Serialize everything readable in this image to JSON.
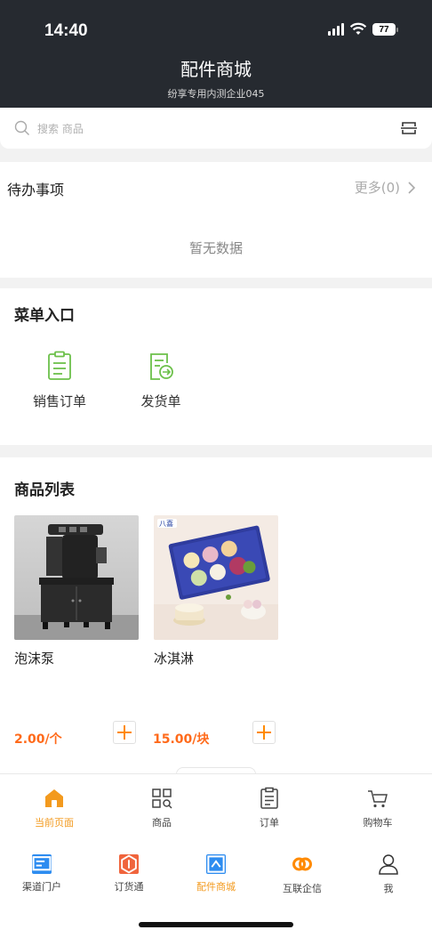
{
  "status": {
    "time": "14:40",
    "battery": "77"
  },
  "header": {
    "title": "配件商城",
    "subtitle": "纷享专用内测企业045"
  },
  "search": {
    "placeholder": "搜索 商品"
  },
  "todo": {
    "title": "待办事项",
    "more": "更多(0)",
    "empty": "暂无数据"
  },
  "menu": {
    "title": "菜单入口",
    "items": [
      {
        "label": "销售订单",
        "icon": "clipboard-list-icon"
      },
      {
        "label": "发货单",
        "icon": "delivery-doc-icon"
      }
    ]
  },
  "products": {
    "title": "商品列表",
    "items": [
      {
        "name": "泡沫泵",
        "price": "2.00/个",
        "image": "foam-pump-machine-image"
      },
      {
        "name": "冰淇淋",
        "price": "15.00/块",
        "image": "ice-cream-box-image"
      }
    ]
  },
  "tabs": [
    {
      "label": "当前页面",
      "icon": "home-icon",
      "active": true
    },
    {
      "label": "商品",
      "icon": "grid-search-icon",
      "active": false
    },
    {
      "label": "订单",
      "icon": "order-doc-icon",
      "active": false
    },
    {
      "label": "购物车",
      "icon": "cart-icon",
      "active": false
    }
  ],
  "apps": [
    {
      "label": "渠道门户",
      "icon": "channel-portal-icon",
      "color": "#2d8cf0"
    },
    {
      "label": "订货通",
      "icon": "ordering-icon",
      "color": "#f0643c"
    },
    {
      "label": "配件商城",
      "icon": "parts-mall-icon",
      "color": "#2d8cf0",
      "active": true
    },
    {
      "label": "互联企信",
      "icon": "link-rings-icon",
      "color": "#ff8a00"
    },
    {
      "label": "我",
      "icon": "person-icon",
      "color": "#333333"
    }
  ],
  "colors": {
    "accent": "#f39a1e",
    "price": "#ff6a1a",
    "header": "#262a30",
    "green": "#6cc04a"
  }
}
